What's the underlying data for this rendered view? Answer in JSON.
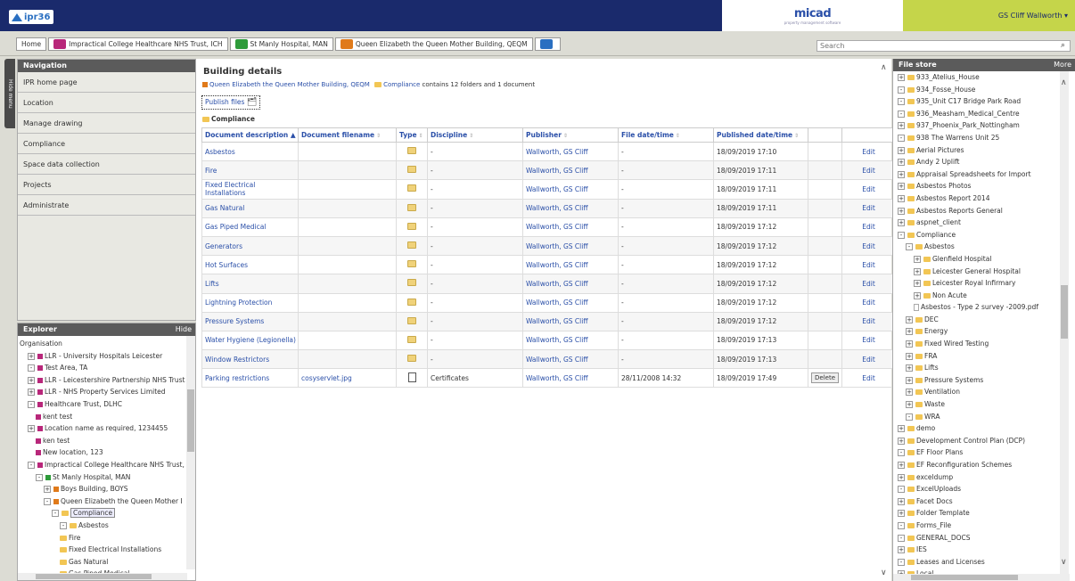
{
  "app": {
    "logo_text": "ipr36",
    "brand": "micad",
    "brand_sub": "property management software",
    "user": "GS Cliff Wallworth ▾"
  },
  "breadcrumb": [
    {
      "label": "Home",
      "color": ""
    },
    {
      "label": "Impractical College Healthcare NHS Trust, ICH",
      "color": "#b8277a"
    },
    {
      "label": "St Manly Hospital, MAN",
      "color": "#2e9b3a"
    },
    {
      "label": "Queen Elizabeth the Queen Mother Building, QEQM",
      "color": "#e07a1a"
    },
    {
      "label": "",
      "color": "#2a6fc1"
    }
  ],
  "search": {
    "placeholder": "Search"
  },
  "hide_menu": "Hide menu",
  "navigation": {
    "title": "Navigation",
    "items": [
      "IPR home page",
      "Location",
      "Manage drawing",
      "Compliance",
      "Space data collection",
      "Projects",
      "Administrate"
    ]
  },
  "explorer": {
    "title": "Explorer",
    "hide": "Hide",
    "rows": [
      {
        "label": "Organisation",
        "indent": 0,
        "exp": "",
        "icon": ""
      },
      {
        "label": "LLR - University Hospitals Leicester",
        "indent": 1,
        "exp": "+",
        "icon": "#b8277a"
      },
      {
        "label": "Test Area, TA",
        "indent": 1,
        "exp": "-",
        "icon": "#b8277a"
      },
      {
        "label": "LLR - Leicestershire Partnership NHS Trust",
        "indent": 1,
        "exp": "+",
        "icon": "#b8277a"
      },
      {
        "label": "LLR - NHS Property Services Limited",
        "indent": 1,
        "exp": "+",
        "icon": "#b8277a"
      },
      {
        "label": "Healthcare Trust, DLHC",
        "indent": 1,
        "exp": "-",
        "icon": "#b8277a"
      },
      {
        "label": "kent test",
        "indent": 2,
        "exp": "",
        "icon": "#b8277a"
      },
      {
        "label": "Location name as required, 1234455",
        "indent": 1,
        "exp": "+",
        "icon": "#b8277a"
      },
      {
        "label": "ken test",
        "indent": 2,
        "exp": "",
        "icon": "#b8277a"
      },
      {
        "label": "New location, 123",
        "indent": 2,
        "exp": "",
        "icon": "#b8277a"
      },
      {
        "label": "Impractical College Healthcare NHS Trust,",
        "indent": 1,
        "exp": "-",
        "icon": "#b8277a"
      },
      {
        "label": "St Manly Hospital, MAN",
        "indent": 2,
        "exp": "-",
        "icon": "#2e9b3a"
      },
      {
        "label": "Boys Building, BOYS",
        "indent": 3,
        "exp": "+",
        "icon": "#e07a1a"
      },
      {
        "label": "Queen Elizabeth the Queen Mother I",
        "indent": 3,
        "exp": "-",
        "icon": "#e07a1a"
      },
      {
        "label": "Compliance",
        "indent": 4,
        "exp": "-",
        "icon": "folder",
        "selected": true
      },
      {
        "label": "Asbestos",
        "indent": 5,
        "exp": "-",
        "icon": "folder"
      },
      {
        "label": "Fire",
        "indent": 5,
        "exp": "",
        "icon": "folder"
      },
      {
        "label": "Fixed Electrical Installations",
        "indent": 5,
        "exp": "",
        "icon": "folder"
      },
      {
        "label": "Gas Natural",
        "indent": 5,
        "exp": "",
        "icon": "folder"
      },
      {
        "label": "Gas Piped Medical",
        "indent": 5,
        "exp": "",
        "icon": "folder"
      }
    ]
  },
  "main": {
    "title": "Building details",
    "path_building": "Queen Elizabeth the Queen Mother Building, QEQM",
    "path_folder": "Compliance",
    "path_suffix": " contains 12 folders and 1 document",
    "publish_label": "Publish files",
    "current_folder": "Compliance",
    "columns": [
      "Document description ▲",
      "Document filename",
      "Type",
      "Discipline",
      "Publisher",
      "File date/time",
      "Published date/time",
      "",
      ""
    ],
    "rows": [
      {
        "desc": "Asbestos",
        "file": "",
        "type": "folder-open",
        "disc": "-",
        "pub": "Wallworth, GS Cliff",
        "fdate": "-",
        "pdate": "18/09/2019 17:10",
        "del": "",
        "edit": "Edit"
      },
      {
        "desc": "Fire",
        "file": "",
        "type": "folder",
        "disc": "-",
        "pub": "Wallworth, GS Cliff",
        "fdate": "-",
        "pdate": "18/09/2019 17:11",
        "del": "",
        "edit": "Edit"
      },
      {
        "desc": "Fixed Electrical Installations",
        "file": "",
        "type": "folder",
        "disc": "-",
        "pub": "Wallworth, GS Cliff",
        "fdate": "-",
        "pdate": "18/09/2019 17:11",
        "del": "",
        "edit": "Edit"
      },
      {
        "desc": "Gas Natural",
        "file": "",
        "type": "folder",
        "disc": "-",
        "pub": "Wallworth, GS Cliff",
        "fdate": "-",
        "pdate": "18/09/2019 17:11",
        "del": "",
        "edit": "Edit"
      },
      {
        "desc": "Gas Piped Medical",
        "file": "",
        "type": "folder",
        "disc": "-",
        "pub": "Wallworth, GS Cliff",
        "fdate": "-",
        "pdate": "18/09/2019 17:12",
        "del": "",
        "edit": "Edit"
      },
      {
        "desc": "Generators",
        "file": "",
        "type": "folder",
        "disc": "-",
        "pub": "Wallworth, GS Cliff",
        "fdate": "-",
        "pdate": "18/09/2019 17:12",
        "del": "",
        "edit": "Edit"
      },
      {
        "desc": "Hot Surfaces",
        "file": "",
        "type": "folder",
        "disc": "-",
        "pub": "Wallworth, GS Cliff",
        "fdate": "-",
        "pdate": "18/09/2019 17:12",
        "del": "",
        "edit": "Edit"
      },
      {
        "desc": "Lifts",
        "file": "",
        "type": "folder",
        "disc": "-",
        "pub": "Wallworth, GS Cliff",
        "fdate": "-",
        "pdate": "18/09/2019 17:12",
        "del": "",
        "edit": "Edit"
      },
      {
        "desc": "Lightning Protection",
        "file": "",
        "type": "folder",
        "disc": "-",
        "pub": "Wallworth, GS Cliff",
        "fdate": "-",
        "pdate": "18/09/2019 17:12",
        "del": "",
        "edit": "Edit"
      },
      {
        "desc": "Pressure Systems",
        "file": "",
        "type": "folder",
        "disc": "-",
        "pub": "Wallworth, GS Cliff",
        "fdate": "-",
        "pdate": "18/09/2019 17:12",
        "del": "",
        "edit": "Edit"
      },
      {
        "desc": "Water Hygiene (Legionella)",
        "file": "",
        "type": "folder",
        "disc": "-",
        "pub": "Wallworth, GS Cliff",
        "fdate": "-",
        "pdate": "18/09/2019 17:13",
        "del": "",
        "edit": "Edit"
      },
      {
        "desc": "Window Restrictors",
        "file": "",
        "type": "folder",
        "disc": "-",
        "pub": "Wallworth, GS Cliff",
        "fdate": "-",
        "pdate": "18/09/2019 17:13",
        "del": "",
        "edit": "Edit"
      },
      {
        "desc": "Parking restrictions",
        "file": "cosyservlet.jpg",
        "type": "image",
        "disc": "Certificates",
        "pub": "Wallworth, GS Cliff",
        "fdate": "28/11/2008 14:32",
        "pdate": "18/09/2019 17:49",
        "del": "Delete",
        "edit": "Edit"
      }
    ]
  },
  "filestore": {
    "title": "File store",
    "more": "More",
    "rows": [
      {
        "label": "933_Atelius_House",
        "indent": 0,
        "exp": "+"
      },
      {
        "label": "934_Fosse_House",
        "indent": 0,
        "exp": "-"
      },
      {
        "label": "935_Unit C17 Bridge Park Road",
        "indent": 0,
        "exp": "-"
      },
      {
        "label": "936_Measham_Medical_Centre",
        "indent": 0,
        "exp": "-"
      },
      {
        "label": "937_Phoenix_Park_Nottingham",
        "indent": 0,
        "exp": "+"
      },
      {
        "label": "938 The Warrens Unit 25",
        "indent": 0,
        "exp": "-"
      },
      {
        "label": "Aerial Pictures",
        "indent": 0,
        "exp": "+"
      },
      {
        "label": "Andy 2 Uplift",
        "indent": 0,
        "exp": "+"
      },
      {
        "label": "Appraisal Spreadsheets for Import",
        "indent": 0,
        "exp": "+"
      },
      {
        "label": "Asbestos Photos",
        "indent": 0,
        "exp": "+"
      },
      {
        "label": "Asbestos Report 2014",
        "indent": 0,
        "exp": "+"
      },
      {
        "label": "Asbestos Reports General",
        "indent": 0,
        "exp": "+"
      },
      {
        "label": "aspnet_client",
        "indent": 0,
        "exp": "+"
      },
      {
        "label": "Compliance",
        "indent": 0,
        "exp": "-"
      },
      {
        "label": "Asbestos",
        "indent": 1,
        "exp": "-"
      },
      {
        "label": "Glenfield Hospital",
        "indent": 2,
        "exp": "+"
      },
      {
        "label": "Leicester General Hospital",
        "indent": 2,
        "exp": "+"
      },
      {
        "label": "Leicester Royal Infirmary",
        "indent": 2,
        "exp": "+"
      },
      {
        "label": "Non Acute",
        "indent": 2,
        "exp": "+"
      },
      {
        "label": "Asbestos - Type 2 survey -2009.pdf",
        "indent": 2,
        "exp": "",
        "doc": true
      },
      {
        "label": "DEC",
        "indent": 1,
        "exp": "+"
      },
      {
        "label": "Energy",
        "indent": 1,
        "exp": "+"
      },
      {
        "label": "Fixed Wired Testing",
        "indent": 1,
        "exp": "+"
      },
      {
        "label": "FRA",
        "indent": 1,
        "exp": "+"
      },
      {
        "label": "Lifts",
        "indent": 1,
        "exp": "+"
      },
      {
        "label": "Pressure Systems",
        "indent": 1,
        "exp": "+"
      },
      {
        "label": "Ventilation",
        "indent": 1,
        "exp": "+"
      },
      {
        "label": "Waste",
        "indent": 1,
        "exp": "+"
      },
      {
        "label": "WRA",
        "indent": 1,
        "exp": "-"
      },
      {
        "label": "demo",
        "indent": 0,
        "exp": "+"
      },
      {
        "label": "Development Control Plan (DCP)",
        "indent": 0,
        "exp": "+"
      },
      {
        "label": "EF Floor Plans",
        "indent": 0,
        "exp": "-"
      },
      {
        "label": "EF Reconfiguration Schemes",
        "indent": 0,
        "exp": "+"
      },
      {
        "label": "exceldump",
        "indent": 0,
        "exp": "+"
      },
      {
        "label": "ExcelUploads",
        "indent": 0,
        "exp": "-"
      },
      {
        "label": "Facet Docs",
        "indent": 0,
        "exp": "+"
      },
      {
        "label": "Folder Template",
        "indent": 0,
        "exp": "+"
      },
      {
        "label": "Forms_File",
        "indent": 0,
        "exp": "-"
      },
      {
        "label": "GENERAL_DOCS",
        "indent": 0,
        "exp": "-"
      },
      {
        "label": "IES",
        "indent": 0,
        "exp": "+"
      },
      {
        "label": "Leases and Licenses",
        "indent": 0,
        "exp": "-"
      },
      {
        "label": "Local",
        "indent": 0,
        "exp": "+"
      }
    ]
  }
}
